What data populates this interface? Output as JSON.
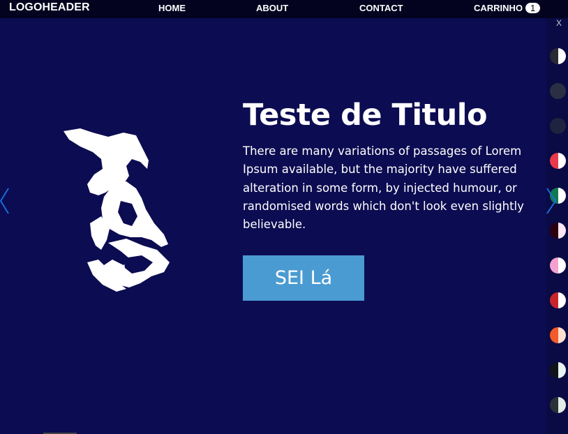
{
  "header": {
    "logo": "LOGOHEADER",
    "nav": [
      {
        "label": "HOME"
      },
      {
        "label": "ABOUT"
      },
      {
        "label": "CONTACT"
      }
    ],
    "cart": {
      "label": "CARRINHO",
      "count": "1"
    }
  },
  "close_label": "X",
  "hero": {
    "title": "Teste de Titulo",
    "description": "There are many variations of passages of Lorem Ipsum available, but the majority have suffered alteration in some form, by injected humour, or randomised words which don't look even slightly believable.",
    "button_label": "SEI Lá"
  },
  "theme_swatches": [
    {
      "left": "#2a2a33",
      "right": "#ffffff"
    },
    {
      "left": "#2a2f44",
      "right": "#2a2f44"
    },
    {
      "left": "#1e2440",
      "right": "#1e2440"
    },
    {
      "left": "#e83a4a",
      "right": "#ffffff"
    },
    {
      "left": "#0f7a4f",
      "right": "#ffffff"
    },
    {
      "left": "#2a0010",
      "right": "#fde6f2"
    },
    {
      "left": "#f4a0d0",
      "right": "#ffffff"
    },
    {
      "left": "#c8242c",
      "right": "#ffffff"
    },
    {
      "left": "#f25a2a",
      "right": "#ffe0cf"
    },
    {
      "left": "#101418",
      "right": "#e8f4f4"
    },
    {
      "left": "#2a3236",
      "right": "#e0ece6"
    }
  ],
  "colors": {
    "background": "#0c0c52",
    "header": "#03031f",
    "button": "#4a9bd2",
    "arrow": "#1a6ed8"
  }
}
